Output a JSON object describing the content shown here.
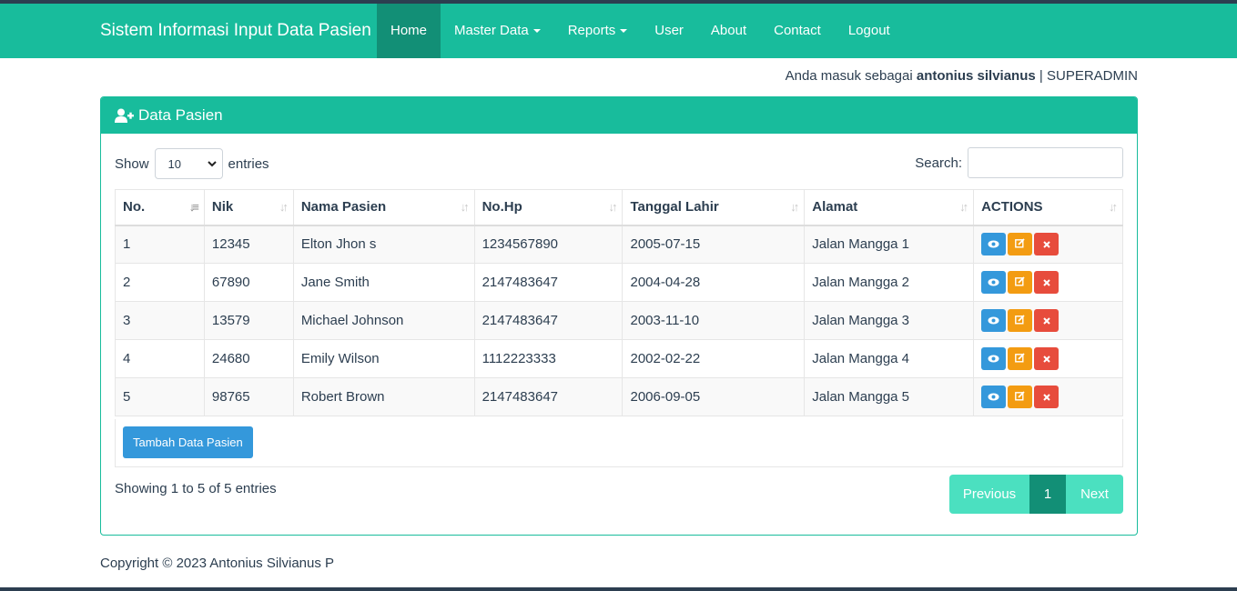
{
  "navbar": {
    "brand": "Sistem Informasi Input Data Pasien",
    "items": [
      {
        "label": "Home"
      },
      {
        "label": "Master Data"
      },
      {
        "label": "Reports"
      },
      {
        "label": "User"
      },
      {
        "label": "About"
      },
      {
        "label": "Contact"
      },
      {
        "label": "Logout"
      }
    ]
  },
  "user_info": {
    "prefix": "Anda masuk sebagai",
    "name": "antonius silvianus",
    "separator": "|",
    "role": "SUPERADMIN"
  },
  "panel": {
    "title": "Data Pasien",
    "show_label": "Show",
    "entries_value": "10",
    "entries_label": "entries",
    "search_label": "Search:",
    "search_value": ""
  },
  "table": {
    "columns": [
      "No.",
      "Nik",
      "Nama Pasien",
      "No.Hp",
      "Tanggal Lahir",
      "Alamat",
      "ACTIONS"
    ],
    "rows": [
      {
        "no": "1",
        "nik": "12345",
        "nama": "Elton Jhon s",
        "hp": "1234567890",
        "tgl": "2005-07-15",
        "alamat": "Jalan Mangga 1"
      },
      {
        "no": "2",
        "nik": "67890",
        "nama": "Jane Smith",
        "hp": "2147483647",
        "tgl": "2004-04-28",
        "alamat": "Jalan Mangga 2"
      },
      {
        "no": "3",
        "nik": "13579",
        "nama": "Michael Johnson",
        "hp": "2147483647",
        "tgl": "2003-11-10",
        "alamat": "Jalan Mangga 3"
      },
      {
        "no": "4",
        "nik": "24680",
        "nama": "Emily Wilson",
        "hp": "1112223333",
        "tgl": "2002-02-22",
        "alamat": "Jalan Mangga 4"
      },
      {
        "no": "5",
        "nik": "98765",
        "nama": "Robert Brown",
        "hp": "2147483647",
        "tgl": "2006-09-05",
        "alamat": "Jalan Mangga 5"
      }
    ],
    "action_icons": [
      "eye-icon",
      "edit-icon",
      "close-icon"
    ]
  },
  "add_button": "Tambah Data Pasien",
  "info_text": "Showing 1 to 5 of 5 entries",
  "pagination": {
    "previous": "Previous",
    "current": "1",
    "next": "Next"
  },
  "footer": "Copyright © 2023 Antonius Silvianus P",
  "colors": {
    "primary": "#18bc9c",
    "dark": "#2c3e50",
    "info": "#3498db",
    "warning": "#f39c12",
    "danger": "#e74c3c"
  }
}
